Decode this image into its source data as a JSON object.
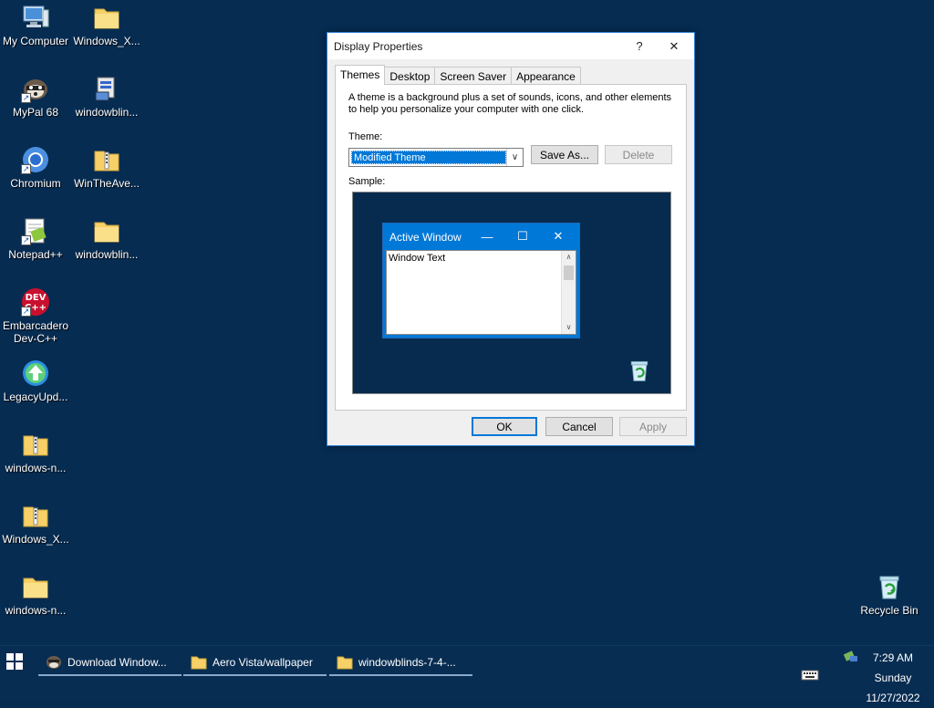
{
  "desktop": {
    "icons": [
      {
        "label": "My Computer"
      },
      {
        "label": "Windows_X..."
      },
      {
        "label": "MyPal 68"
      },
      {
        "label": "windowblin..."
      },
      {
        "label": "Chromium"
      },
      {
        "label": "WinTheAve..."
      },
      {
        "label": "Notepad++"
      },
      {
        "label": "windowblin..."
      },
      {
        "label": "Embarcadero Dev-C++"
      },
      {
        "label": "LegacyUpd..."
      },
      {
        "label": "windows-n..."
      },
      {
        "label": "Windows_X..."
      },
      {
        "label": "windows-n..."
      },
      {
        "label": "Recycle Bin"
      }
    ]
  },
  "dialog": {
    "title": "Display Properties",
    "help": "?",
    "close": "✕",
    "tabs": [
      {
        "label": "Themes"
      },
      {
        "label": "Desktop"
      },
      {
        "label": "Screen Saver"
      },
      {
        "label": "Appearance"
      }
    ],
    "description": "A theme is a background plus a set of sounds, icons, and other elements to help you personalize your computer with one click.",
    "theme_label": "Theme:",
    "theme_value": "Modified Theme",
    "save_as": "Save As...",
    "delete": "Delete",
    "sample_label": "Sample:",
    "sample": {
      "window_title": "Active Window",
      "window_text": "Window Text"
    },
    "ok": "OK",
    "cancel": "Cancel",
    "apply": "Apply"
  },
  "taskbar": {
    "items": [
      {
        "label": "Download Window..."
      },
      {
        "label": "Aero Vista/wallpaper"
      },
      {
        "label": "windowblinds-7-4-..."
      }
    ],
    "time": "7:29 AM",
    "day": "Sunday",
    "date": "11/27/2022"
  },
  "colors": {
    "desktop": "#062c52",
    "accent": "#0078d7",
    "folder": "#f7d168"
  }
}
